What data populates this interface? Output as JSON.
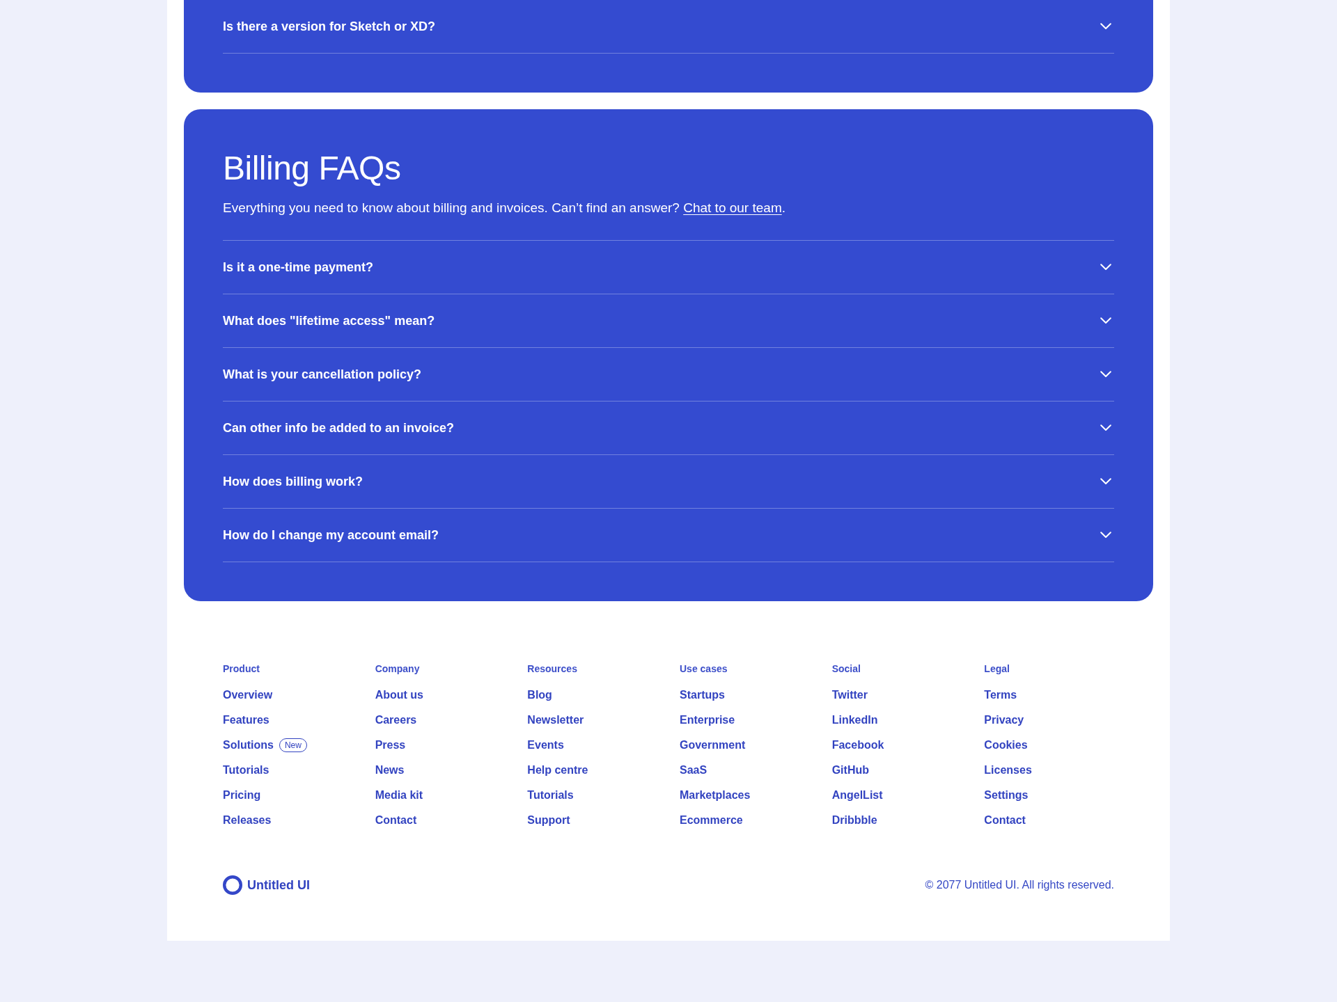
{
  "faq_sections": [
    {
      "questions": [
        {
          "text": "Is there a version for Sketch or XD?",
          "expanded": false
        }
      ]
    },
    {
      "title": "Billing FAQs",
      "description": {
        "text": "Everything you need to know about billing and invoices. Can’t find an answer?",
        "link": "Chat to our team",
        "end": "."
      },
      "questions": [
        {
          "text": "Is it a one-time payment?",
          "expanded": false
        },
        {
          "text": "What does \"lifetime access\" mean?",
          "expanded": false
        },
        {
          "text": "What is your cancellation policy?",
          "expanded": false
        },
        {
          "text": "Can other info be added to an invoice?",
          "expanded": false
        },
        {
          "text": "How does billing work?",
          "expanded": false
        },
        {
          "text": "How do I change my account email?",
          "expanded": false
        }
      ]
    }
  ],
  "footer": {
    "columns": [
      {
        "heading": "Product",
        "links": [
          {
            "label": "Overview"
          },
          {
            "label": "Features"
          },
          {
            "label": "Solutions",
            "badge": "New"
          },
          {
            "label": "Tutorials"
          },
          {
            "label": "Pricing"
          },
          {
            "label": "Releases"
          }
        ]
      },
      {
        "heading": "Company",
        "links": [
          {
            "label": "About us"
          },
          {
            "label": "Careers"
          },
          {
            "label": "Press"
          },
          {
            "label": "News"
          },
          {
            "label": "Media kit"
          },
          {
            "label": "Contact"
          }
        ]
      },
      {
        "heading": "Resources",
        "links": [
          {
            "label": "Blog"
          },
          {
            "label": "Newsletter"
          },
          {
            "label": "Events"
          },
          {
            "label": "Help centre"
          },
          {
            "label": "Tutorials"
          },
          {
            "label": "Support"
          }
        ]
      },
      {
        "heading": "Use cases",
        "links": [
          {
            "label": "Startups"
          },
          {
            "label": "Enterprise"
          },
          {
            "label": "Government"
          },
          {
            "label": "SaaS"
          },
          {
            "label": "Marketplaces"
          },
          {
            "label": "Ecommerce"
          }
        ]
      },
      {
        "heading": "Social",
        "links": [
          {
            "label": "Twitter"
          },
          {
            "label": "LinkedIn"
          },
          {
            "label": "Facebook"
          },
          {
            "label": "GitHub"
          },
          {
            "label": "AngelList"
          },
          {
            "label": "Dribbble"
          }
        ]
      },
      {
        "heading": "Legal",
        "links": [
          {
            "label": "Terms"
          },
          {
            "label": "Privacy"
          },
          {
            "label": "Cookies"
          },
          {
            "label": "Licenses"
          },
          {
            "label": "Settings"
          },
          {
            "label": "Contact"
          }
        ]
      }
    ],
    "brand": "Untitled UI",
    "copyright": "© 2077 Untitled UI. All rights reserved."
  }
}
